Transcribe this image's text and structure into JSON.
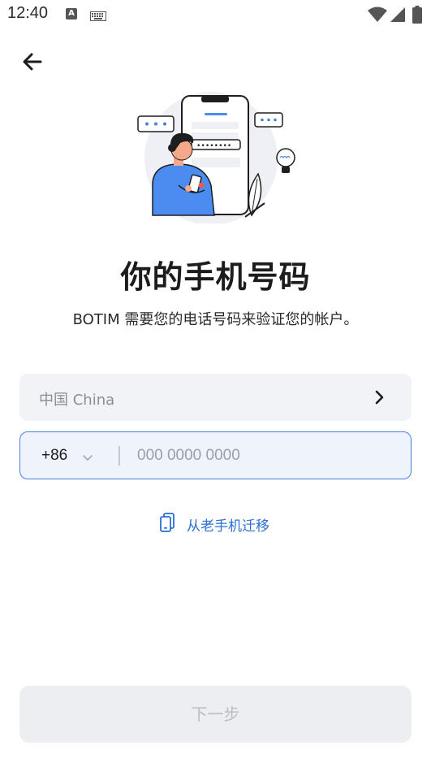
{
  "status_bar": {
    "time": "12:40",
    "notification_icon_letter": "A",
    "icons": [
      "text-notification-icon",
      "keyboard-icon",
      "wifi-icon",
      "signal-icon",
      "battery-icon"
    ]
  },
  "header": {
    "back_icon": "arrow-left-icon"
  },
  "main": {
    "title": "你的手机号码",
    "subtitle": "BOTIM 需要您的电话号码来验证您的帐户。",
    "country": {
      "label": "中国 China",
      "icon": "chevron-right-icon"
    },
    "phone": {
      "dial_code": "+86",
      "dial_icon": "chevron-down-icon",
      "placeholder": "000 0000 0000",
      "value": ""
    },
    "migrate": {
      "label": "从老手机迁移",
      "icon": "phone-copy-icon"
    }
  },
  "footer": {
    "next_label": "下一步"
  },
  "colors": {
    "accent": "#4a7fe0",
    "link": "#2b6fd6",
    "field_bg": "#f2f3f7",
    "active_field_bg": "#eef3fc",
    "disabled_button_bg": "#eceef1",
    "disabled_button_text": "#b9bcc2"
  }
}
